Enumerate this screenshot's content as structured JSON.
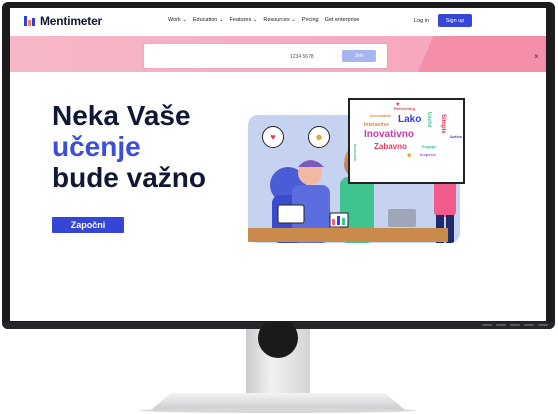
{
  "nav": {
    "brand": "Mentimeter",
    "menu": [
      "Work",
      "Education",
      "Features",
      "Resources",
      "Pricing",
      "Get enterprise"
    ],
    "login": "Log in",
    "signup": "Sign up"
  },
  "join": {
    "code_placeholder": "1234 5678",
    "button": "Join"
  },
  "hero": {
    "line1": "Neka Vaše",
    "line2": "učenje",
    "line3": "bude važno",
    "cta": "Započni"
  },
  "wordcloud": {
    "words": [
      "Refreshing",
      "Accessible",
      "Lako",
      "Interactive",
      "Inovativno",
      "Zabavno",
      "Engage",
      "Inspired",
      "Useful",
      "Simple",
      "Active",
      "Inclusive"
    ]
  },
  "colors": {
    "brand_blue": "#3546d6",
    "headline": "#101834",
    "strip_pink": "#f6b8c8"
  }
}
